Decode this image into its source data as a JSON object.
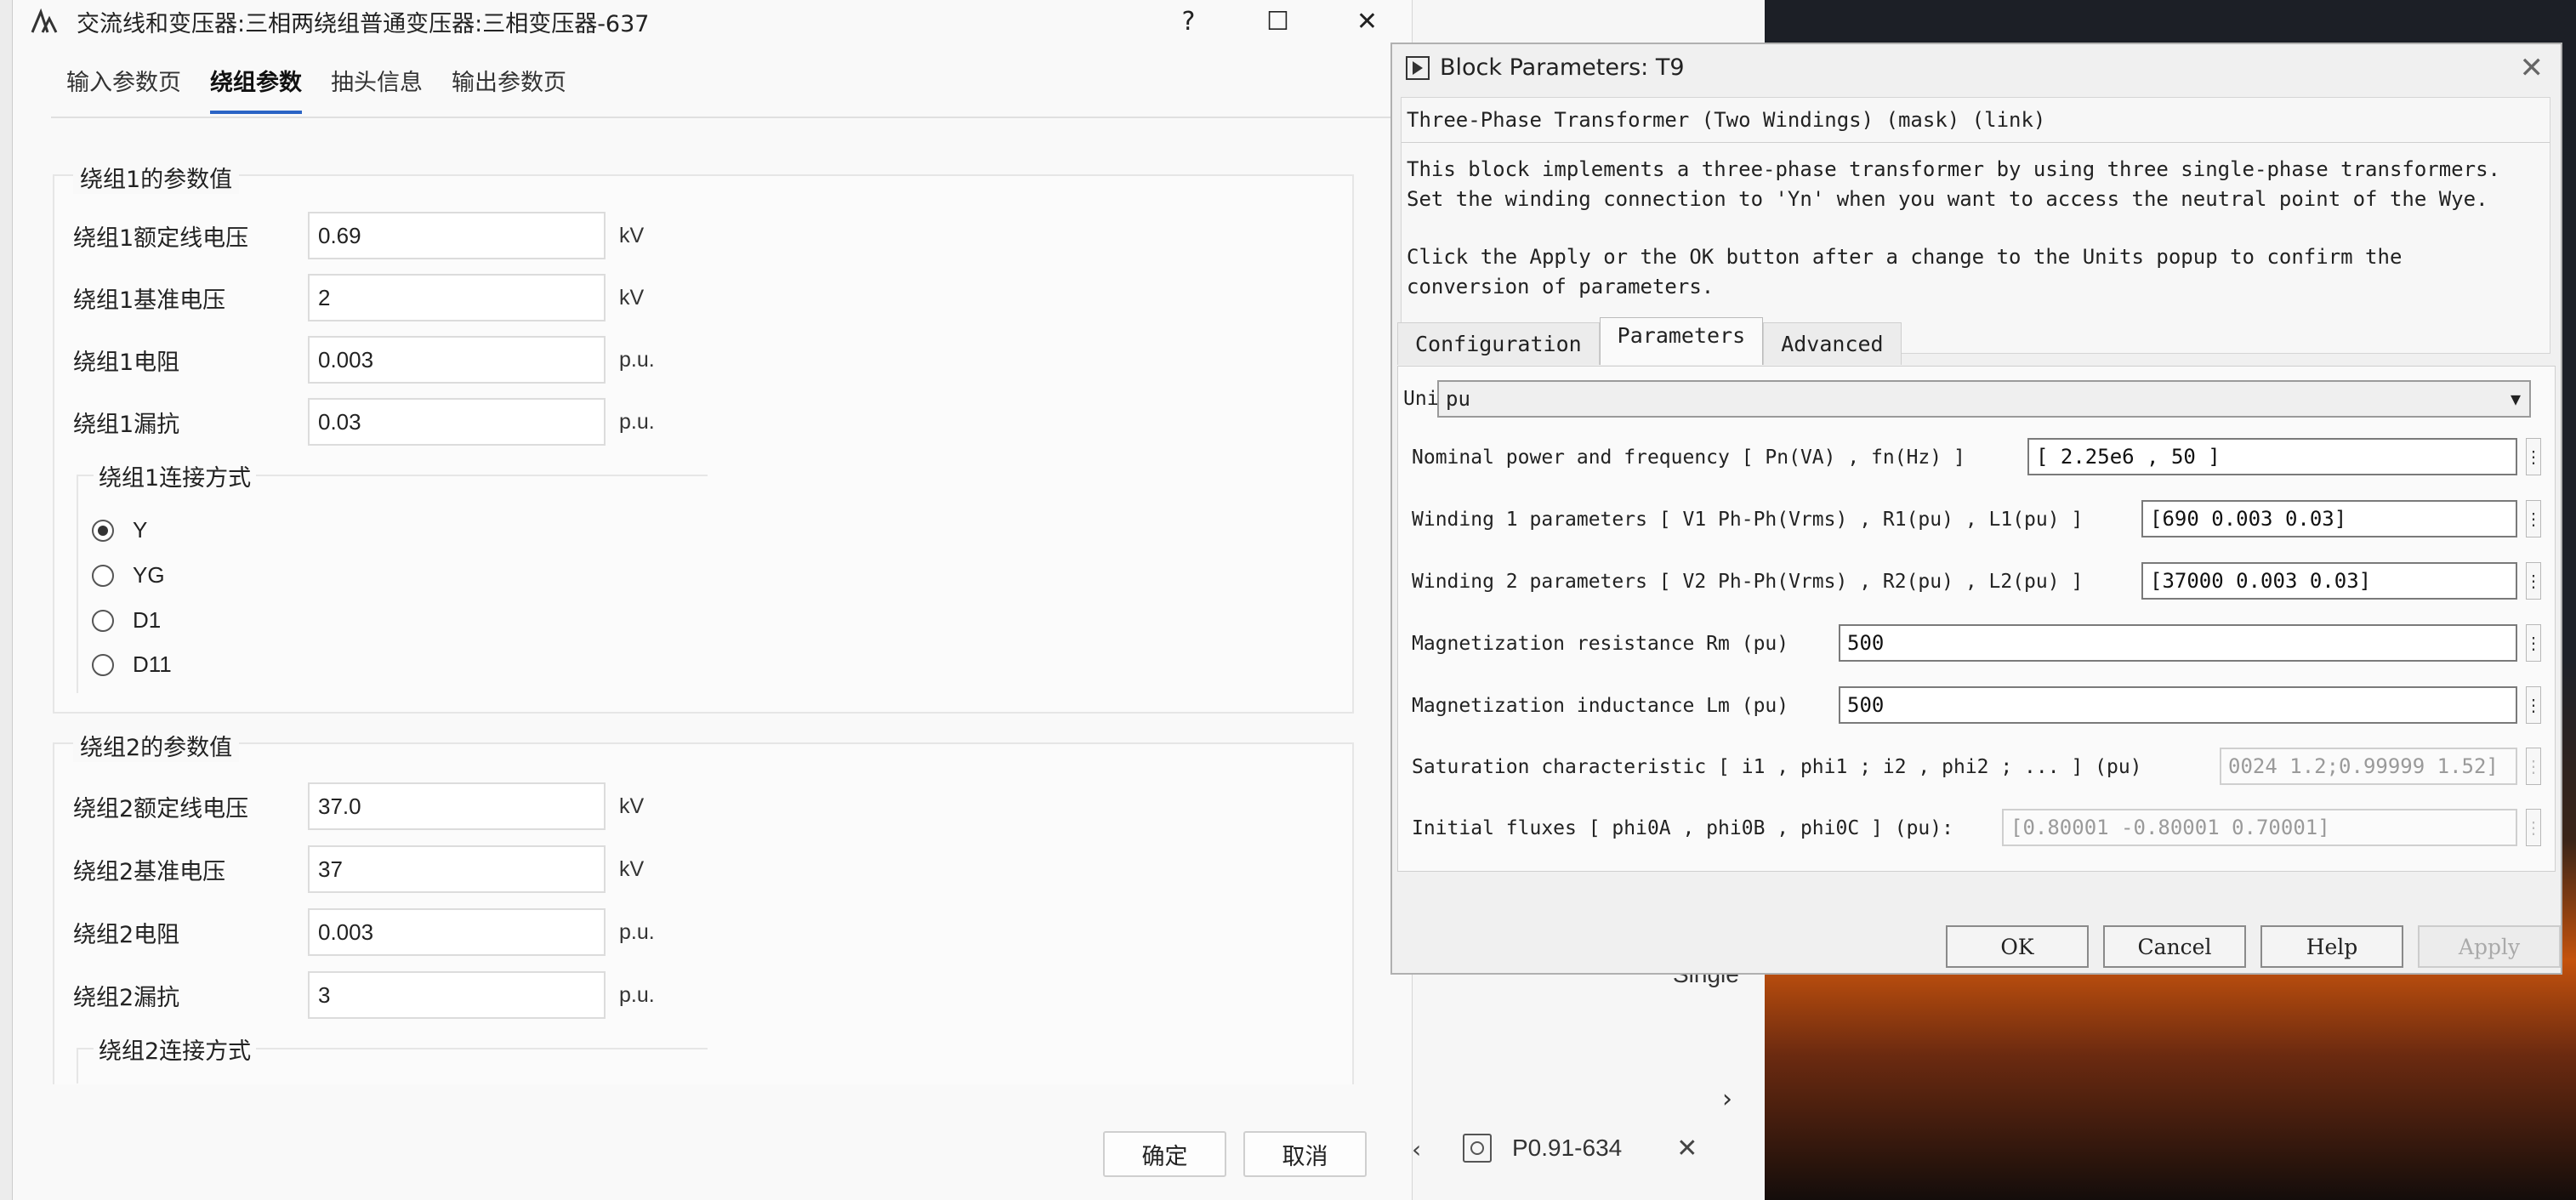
{
  "left_dialog": {
    "title": "交流线和变压器:三相两绕组普通变压器:三相变压器-637",
    "window_buttons": {
      "help": "?",
      "maximize": "☐",
      "close": "✕"
    },
    "tabs": [
      "输入参数页",
      "绕组参数",
      "抽头信息",
      "输出参数页"
    ],
    "active_tab": "绕组参数",
    "winding1": {
      "group_title": "绕组1的参数值",
      "rows": [
        {
          "label": "绕组1额定线电压",
          "value": "0.69",
          "unit": "kV"
        },
        {
          "label": "绕组1基准电压",
          "value": "2",
          "unit": "kV"
        },
        {
          "label": "绕组1电阻",
          "value": "0.003",
          "unit": "p.u."
        },
        {
          "label": "绕组1漏抗",
          "value": "0.03",
          "unit": "p.u."
        }
      ],
      "connection_title": "绕组1连接方式",
      "connection_options": [
        "Y",
        "YG",
        "D1",
        "D11"
      ],
      "connection_selected": "Y"
    },
    "winding2": {
      "group_title": "绕组2的参数值",
      "rows": [
        {
          "label": "绕组2额定线电压",
          "value": "37.0",
          "unit": "kV"
        },
        {
          "label": "绕组2基准电压",
          "value": "37",
          "unit": "kV"
        },
        {
          "label": "绕组2电阻",
          "value": "0.003",
          "unit": "p.u."
        },
        {
          "label": "绕组2漏抗",
          "value": "3",
          "unit": "p.u."
        }
      ],
      "connection_title": "绕组2连接方式"
    },
    "buttons": {
      "ok": "确定",
      "cancel": "取消"
    }
  },
  "block_params": {
    "title": "Block Parameters: T9",
    "close": "✕",
    "mask_title": "Three-Phase Transformer (Two Windings) (mask) (link)",
    "description": [
      "This block implements a three-phase transformer by using three single-phase transformers.",
      "Set the winding connection to 'Yn'  when you want to access the neutral point of the Wye.",
      "Click the Apply or the OK button after a change to the Units popup to confirm the",
      "conversion of parameters."
    ],
    "tabs": [
      "Configuration",
      "Parameters",
      "Advanced"
    ],
    "active_tab": "Parameters",
    "units_label": "Units",
    "units_value": "pu",
    "params": [
      {
        "label": "Nominal power and frequency  [ Pn(VA) , fn(Hz) ]",
        "value": "[ 2.25e6 , 50 ]",
        "enabled": true
      },
      {
        "label": "Winding 1 parameters [ V1 Ph-Ph(Vrms) , R1(pu) , L1(pu) ]",
        "value": "[690 0.003 0.03]",
        "enabled": true
      },
      {
        "label": "Winding 2 parameters [ V2 Ph-Ph(Vrms) , R2(pu) , L2(pu) ]",
        "value": "[37000 0.003 0.03]",
        "enabled": true
      },
      {
        "label": "Magnetization resistance  Rm (pu)",
        "value": "500",
        "enabled": true
      },
      {
        "label": "Magnetization inductance  Lm (pu)",
        "value": "500",
        "enabled": true
      },
      {
        "label": "Saturation characteristic [ i1 ,  phi1 ;  i2 , phi2 ; ... ] (pu)",
        "value": "0024 1.2;0.99999 1.52]",
        "enabled": false
      },
      {
        "label": "Initial fluxes [ phi0A , phi0B , phi0C ] (pu):",
        "value": "[0.80001 -0.80001 0.70001]",
        "enabled": false
      }
    ],
    "buttons": {
      "ok": "OK",
      "cancel": "Cancel",
      "help": "Help",
      "apply": "Apply"
    }
  },
  "background": {
    "partial_label": "Single",
    "tab_label": "P0.91-634",
    "tab_close": "✕",
    "scroll_arrow": "›",
    "chevron": "‹"
  }
}
